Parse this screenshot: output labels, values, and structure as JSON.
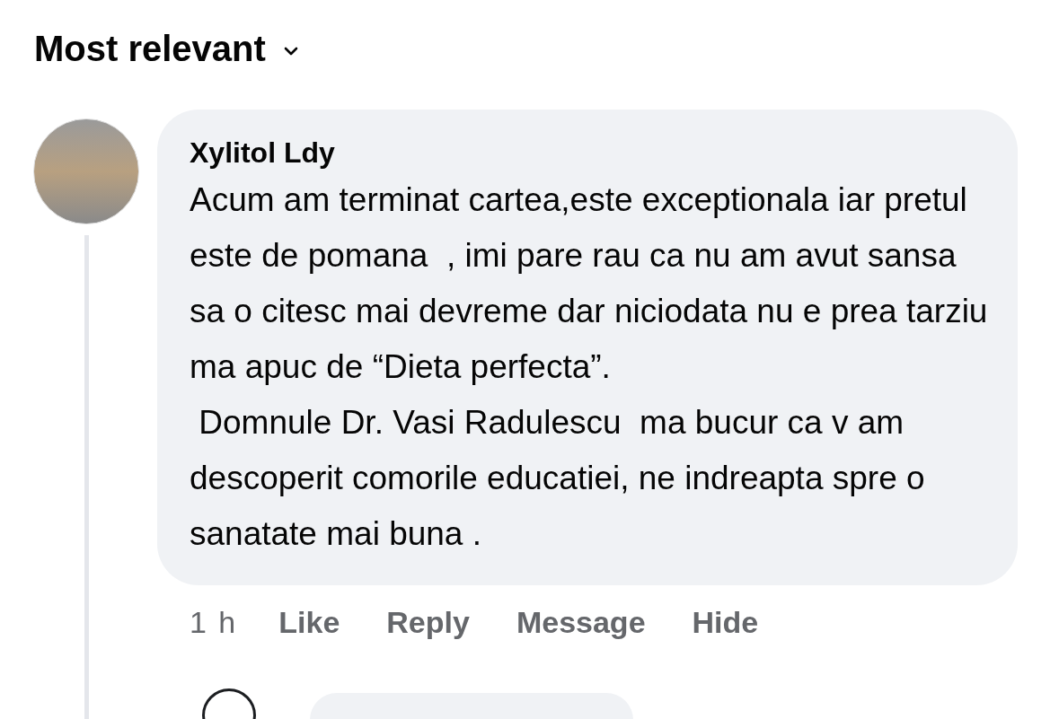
{
  "sort_menu": {
    "label": "Most relevant",
    "expanded": false
  },
  "comment": {
    "author": "Xylitol Ldy",
    "text": "Acum am terminat cartea,este exceptionala iar pretul este de pomana  , imi pare rau ca nu am avut sansa sa o citesc mai devreme dar niciodata nu e prea tarziu ma apuc de “Dieta perfecta”.\n Domnule Dr. Vasi Radulescu  ma bucur ca v am descoperit comorile educatiei, ne indreapta spre o sanatate mai buna .",
    "time": "1 h",
    "actions": [
      "Like",
      "Reply",
      "Message",
      "Hide"
    ]
  }
}
